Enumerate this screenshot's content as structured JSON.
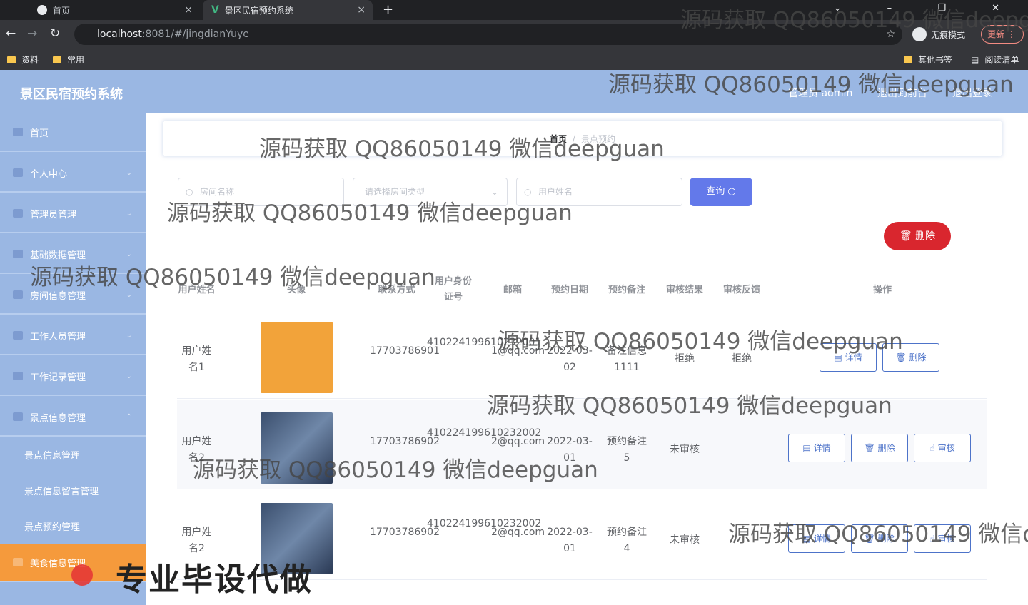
{
  "browser": {
    "tabs": [
      {
        "title": "首页",
        "close": "×"
      },
      {
        "title": "景区民宿预约系统",
        "close": "×"
      }
    ],
    "new_tab": "+",
    "url_host": "localhost",
    "url_rest": ":8081/#/jingdianYuye",
    "incognito_label": "无痕模式",
    "update_label": "更新",
    "bookmarks": [
      "资料",
      "常用"
    ],
    "bookmarks_right": [
      "其他书签",
      "阅读清单"
    ]
  },
  "header": {
    "title": "景区民宿预约系统",
    "user_label": "管理员 admin",
    "front_link": "退出到前台",
    "logout_link": "退出登录"
  },
  "sidebar": {
    "items": [
      {
        "label": "首页",
        "icon": "home-icon"
      },
      {
        "label": "个人中心",
        "icon": "user-icon"
      },
      {
        "label": "管理员管理",
        "icon": "menu-icon"
      },
      {
        "label": "基础数据管理",
        "icon": "menu-icon"
      },
      {
        "label": "房间信息管理",
        "icon": "menu-icon"
      },
      {
        "label": "工作人员管理",
        "icon": "menu-icon"
      },
      {
        "label": "工作记录管理",
        "icon": "menu-icon"
      },
      {
        "label": "景点信息管理",
        "icon": "menu-icon"
      }
    ],
    "subitems": [
      "景点信息管理",
      "景点信息留言管理",
      "景点预约管理"
    ],
    "active_item": "美食信息管理"
  },
  "breadcrumb": {
    "home": "首页",
    "separator": "/",
    "current": "景点预约"
  },
  "search": {
    "room_placeholder": "房间名称",
    "type_placeholder": "请选择房间类型",
    "user_placeholder": "用户姓名",
    "query_label": "查询"
  },
  "toolbar": {
    "delete_label": "删除"
  },
  "table": {
    "headers": [
      "用户姓名",
      "头像",
      "联系方式",
      "用户身份证号",
      "邮箱",
      "预约日期",
      "预约备注",
      "审核结果",
      "审核反馈",
      "操作"
    ],
    "rows": [
      {
        "name": "用户姓名1",
        "phone": "17703786901",
        "idcard": "410224199610232001",
        "email": "1@qq.com",
        "date": "2022-03-02",
        "note": "备注信息1111",
        "result": "拒绝",
        "feedback": "拒绝",
        "actions": [
          "详情",
          "删除"
        ]
      },
      {
        "name": "用户姓名2",
        "phone": "17703786902",
        "idcard": "410224199610232002",
        "email": "2@qq.com",
        "date": "2022-03-01",
        "note": "预约备注5",
        "result": "未审核",
        "feedback": "",
        "actions": [
          "详情",
          "删除",
          "审核"
        ]
      },
      {
        "name": "用户姓名2",
        "phone": "17703786902",
        "idcard": "410224199610232002",
        "email": "2@qq.com",
        "date": "2022-03-01",
        "note": "预约备注4",
        "result": "未审核",
        "feedback": "",
        "actions": [
          "详情",
          "删除",
          "审核"
        ]
      }
    ]
  },
  "overlay": {
    "watermark": "源码获取 QQ86050149 微信deepguan",
    "promo": "专业毕设代做"
  }
}
